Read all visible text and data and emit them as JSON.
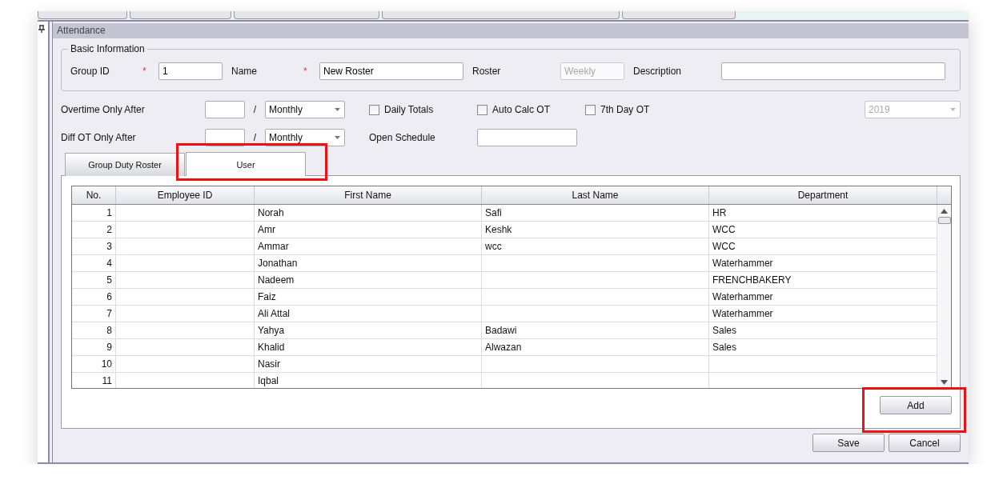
{
  "panel": {
    "title": "Attendance"
  },
  "basic_information": {
    "legend": "Basic Information",
    "fields": [
      {
        "label": "Group ID",
        "required": true,
        "required_mark": "*",
        "value": "1",
        "disabled": false
      },
      {
        "label": "Name",
        "required": true,
        "required_mark": "*",
        "value": "New Roster",
        "disabled": false
      },
      {
        "label": "Roster",
        "required": false,
        "placeholder": "Weekly",
        "disabled": true
      },
      {
        "label": "Description",
        "required": false,
        "disabled": false
      }
    ]
  },
  "overtime_row": {
    "label": "Overtime Only After",
    "separator": "/",
    "period": "Monthly",
    "checkboxes": [
      {
        "label": "Daily Totals",
        "checked": false
      },
      {
        "label": "Auto Calc OT",
        "checked": false
      },
      {
        "label": "7th Day OT",
        "checked": false
      }
    ],
    "year": "2019",
    "year_disabled": true
  },
  "diff_ot_row": {
    "label": "Diff OT Only After",
    "separator": "/",
    "period": "Monthly",
    "open_schedule_label": "Open Schedule"
  },
  "tabs": [
    {
      "label": "Group Duty Roster",
      "selected": false,
      "highlighted": false
    },
    {
      "label": "User",
      "selected": true,
      "highlighted": true
    }
  ],
  "table": {
    "columns": [
      "No.",
      "Employee ID",
      "First Name",
      "Last Name",
      "Department"
    ],
    "rows": [
      [
        "1",
        "",
        "Norah",
        "Safi",
        "HR"
      ],
      [
        "2",
        "",
        "Amr",
        "Keshk",
        "WCC"
      ],
      [
        "3",
        "",
        "Ammar",
        "wcc",
        "WCC"
      ],
      [
        "4",
        "",
        "Jonathan",
        "",
        "Waterhammer"
      ],
      [
        "5",
        "",
        "Nadeem",
        "",
        "FRENCHBAKERY"
      ],
      [
        "6",
        "",
        "Faiz",
        "",
        "Waterhammer"
      ],
      [
        "7",
        "",
        "Ali Attal",
        "",
        "Waterhammer"
      ],
      [
        "8",
        "",
        "Yahya",
        "Badawi",
        "Sales"
      ],
      [
        "9",
        "",
        "Khalid",
        "Alwazan",
        "Sales"
      ],
      [
        "10",
        "",
        "Nasir",
        "",
        ""
      ],
      [
        "11",
        "",
        "Iqbal",
        "",
        ""
      ]
    ]
  },
  "add_button": {
    "label": "Add",
    "highlighted": true
  },
  "buttons": [
    "Save",
    "Cancel"
  ]
}
